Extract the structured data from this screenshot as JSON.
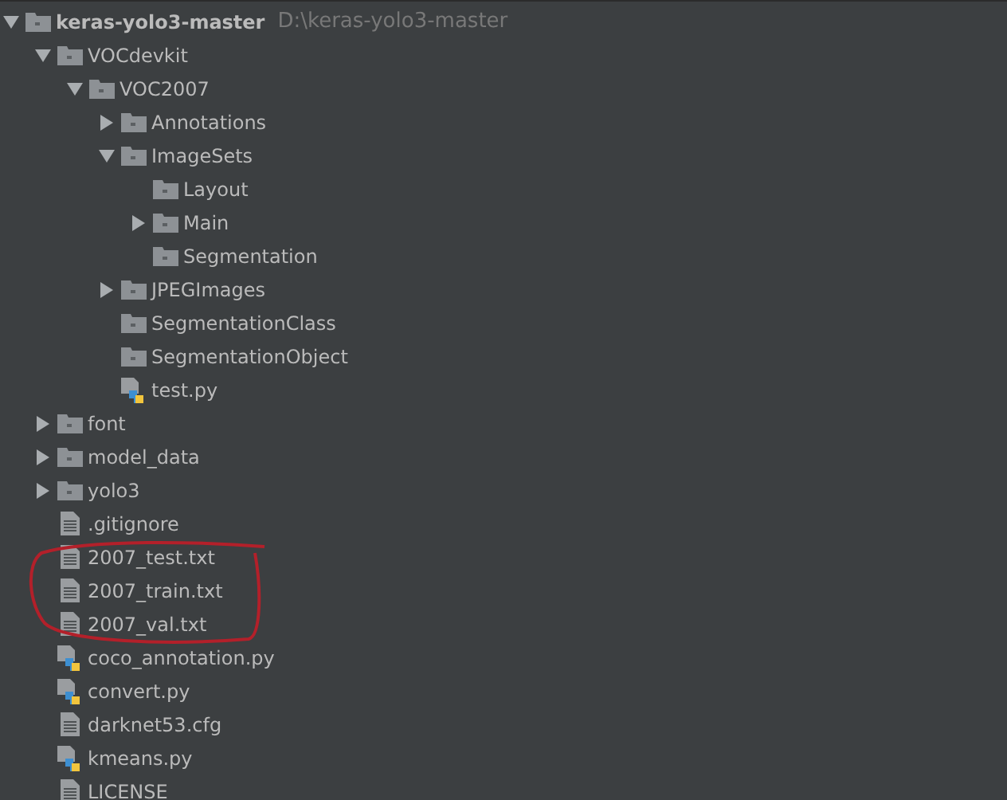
{
  "tree": [
    {
      "kind": "folder",
      "label": "keras-yolo3-master",
      "path": "D:\\keras-yolo3-master",
      "expanded": true,
      "children": [
        {
          "kind": "folder",
          "label": "VOCdevkit",
          "expanded": true,
          "children": [
            {
              "kind": "folder",
              "label": "VOC2007",
              "expanded": true,
              "children": [
                {
                  "kind": "folder",
                  "label": "Annotations",
                  "expanded": false
                },
                {
                  "kind": "folder",
                  "label": "ImageSets",
                  "expanded": true,
                  "children": [
                    {
                      "kind": "folder",
                      "label": "Layout"
                    },
                    {
                      "kind": "folder",
                      "label": "Main",
                      "expanded": false
                    },
                    {
                      "kind": "folder",
                      "label": "Segmentation"
                    }
                  ]
                },
                {
                  "kind": "folder",
                  "label": "JPEGImages",
                  "expanded": false
                },
                {
                  "kind": "folder",
                  "label": "SegmentationClass"
                },
                {
                  "kind": "folder",
                  "label": "SegmentationObject"
                },
                {
                  "kind": "python",
                  "label": "test.py"
                }
              ]
            }
          ]
        },
        {
          "kind": "folder",
          "label": "font",
          "expanded": false
        },
        {
          "kind": "folder",
          "label": "model_data",
          "expanded": false
        },
        {
          "kind": "folder",
          "label": "yolo3",
          "expanded": false
        },
        {
          "kind": "file",
          "label": ".gitignore"
        },
        {
          "kind": "file",
          "label": "2007_test.txt"
        },
        {
          "kind": "file",
          "label": "2007_train.txt"
        },
        {
          "kind": "file",
          "label": "2007_val.txt"
        },
        {
          "kind": "python",
          "label": "coco_annotation.py"
        },
        {
          "kind": "python",
          "label": "convert.py"
        },
        {
          "kind": "file",
          "label": "darknet53.cfg"
        },
        {
          "kind": "python",
          "label": "kmeans.py"
        },
        {
          "kind": "file",
          "label": "LICENSE"
        }
      ]
    }
  ]
}
